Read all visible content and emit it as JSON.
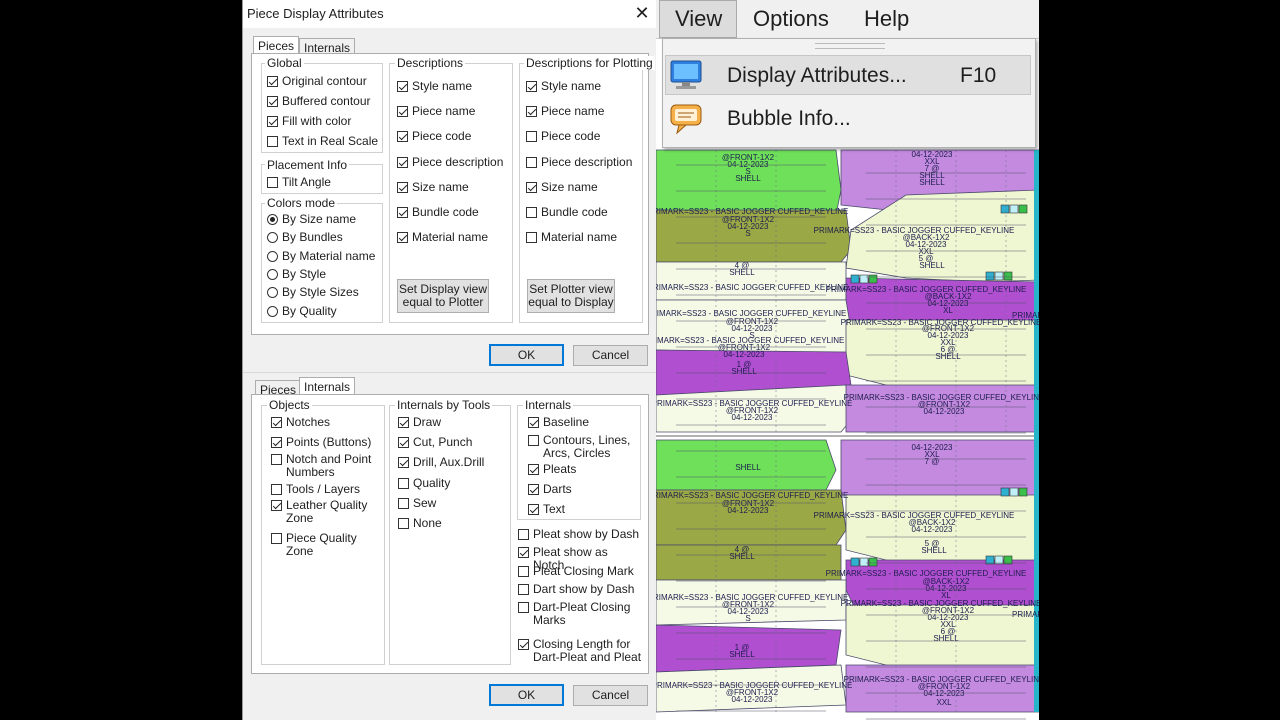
{
  "dialog": {
    "title": "Piece Display Attributes",
    "close_glyph": "✕",
    "top": {
      "tabs": [
        "Pieces",
        "Internals"
      ],
      "global": {
        "title": "Global",
        "items": [
          {
            "label": "Original contour",
            "checked": true
          },
          {
            "label": "Buffered contour",
            "checked": true
          },
          {
            "label": "Fill with color",
            "checked": true
          },
          {
            "label": "Text in Real Scale",
            "checked": false
          }
        ]
      },
      "placement": {
        "title": "Placement Info",
        "items": [
          {
            "label": "Tilt Angle",
            "checked": false
          }
        ]
      },
      "colors": {
        "title": "Colors mode",
        "items": [
          {
            "label": "By Size name",
            "selected": true
          },
          {
            "label": "By Bundles",
            "selected": false
          },
          {
            "label": "By Material name",
            "selected": false
          },
          {
            "label": "By Style",
            "selected": false
          },
          {
            "label": "By Style Sizes",
            "selected": false
          },
          {
            "label": "By Quality",
            "selected": false
          }
        ]
      },
      "descriptions": {
        "title": "Descriptions",
        "items": [
          {
            "label": "Style name",
            "checked": true
          },
          {
            "label": "Piece name",
            "checked": true
          },
          {
            "label": "Piece code",
            "checked": true
          },
          {
            "label": "Piece description",
            "checked": true
          },
          {
            "label": "Size name",
            "checked": true
          },
          {
            "label": "Bundle code",
            "checked": true
          },
          {
            "label": "Material name",
            "checked": true
          }
        ],
        "button": [
          "Set Display view",
          "equal to Plotter"
        ]
      },
      "plotting": {
        "title": "Descriptions for Plotting",
        "items": [
          {
            "label": "Style name",
            "checked": true
          },
          {
            "label": "Piece name",
            "checked": true
          },
          {
            "label": "Piece code",
            "checked": false
          },
          {
            "label": "Piece description",
            "checked": false
          },
          {
            "label": "Size name",
            "checked": true
          },
          {
            "label": "Bundle code",
            "checked": false
          },
          {
            "label": "Material name",
            "checked": false
          }
        ],
        "button": [
          "Set Plotter view",
          "equal to Display"
        ]
      },
      "ok": "OK",
      "cancel": "Cancel"
    },
    "bottom": {
      "tabs": [
        "Pieces",
        "Internals"
      ],
      "objects": {
        "title": "Objects",
        "items": [
          {
            "label": "Notches",
            "checked": true
          },
          {
            "label": "Points (Buttons)",
            "checked": true
          },
          {
            "label": "Notch and Point Numbers",
            "checked": false
          },
          {
            "label": "Tools / Layers",
            "checked": false
          },
          {
            "label": "Leather Quality Zone",
            "checked": true
          },
          {
            "label": "Piece Quality Zone",
            "checked": false
          }
        ]
      },
      "tools": {
        "title": "Internals by Tools",
        "items": [
          {
            "label": "Draw",
            "checked": true
          },
          {
            "label": "Cut,  Punch",
            "checked": true
          },
          {
            "label": "Drill,  Aux.Drill",
            "checked": true
          },
          {
            "label": "Quality",
            "checked": false
          },
          {
            "label": "Sew",
            "checked": false
          },
          {
            "label": "None",
            "checked": false
          }
        ]
      },
      "internals": {
        "title": "Internals",
        "items": [
          {
            "label": "Baseline",
            "checked": true
          },
          {
            "label": "Contours, Lines, Arcs, Circles",
            "checked": false
          },
          {
            "label": "Pleats",
            "checked": true
          },
          {
            "label": "Darts",
            "checked": true
          },
          {
            "label": "Text",
            "checked": true
          }
        ]
      },
      "pleat_opts": [
        {
          "label": "Pleat show by Dash",
          "checked": false
        },
        {
          "label": "Pleat show as Notch",
          "checked": true
        },
        {
          "label": "Pleat Closing Mark",
          "checked": false
        },
        {
          "label": "Dart show by Dash",
          "checked": false
        },
        {
          "label": "Dart-Pleat Closing Marks",
          "checked": false
        },
        {
          "label": "Closing Length for Dart-Pleat and Pleat",
          "checked": true
        }
      ],
      "ok": "OK",
      "cancel": "Cancel"
    }
  },
  "menubar": [
    "View",
    "Options",
    "Help"
  ],
  "view_menu": [
    {
      "label": "Display Attributes...",
      "shortcut": "F10",
      "icon": "monitor-icon"
    },
    {
      "label": "Bubble Info...",
      "shortcut": "",
      "icon": "speech-bubble-icon"
    }
  ],
  "marker": {
    "lines": {
      "front": "PRIMARK=SS23 - BASIC JOGGER CUFFED_KEYLINE",
      "front_tag": "@FRONT-1X2",
      "back_tag": "@BACK-1X2",
      "date": "04-12-2023",
      "shell": "SHELL",
      "size_s": "S",
      "size_xxl": "XXL",
      "size_xl": "XL",
      "primark": "PRIMAR",
      "num": "4 @",
      "num2": "3 @",
      "num3": "6 @",
      "num4": "7 @",
      "num5": "1 @",
      "num6": "5 @"
    },
    "colors": {
      "green": "#6ee05a",
      "olive": "#9aa845",
      "magenta": "#b04fd0",
      "lavender": "#c48ae0",
      "cream": "#eef7d2",
      "lightcream": "#f4fae6"
    }
  }
}
